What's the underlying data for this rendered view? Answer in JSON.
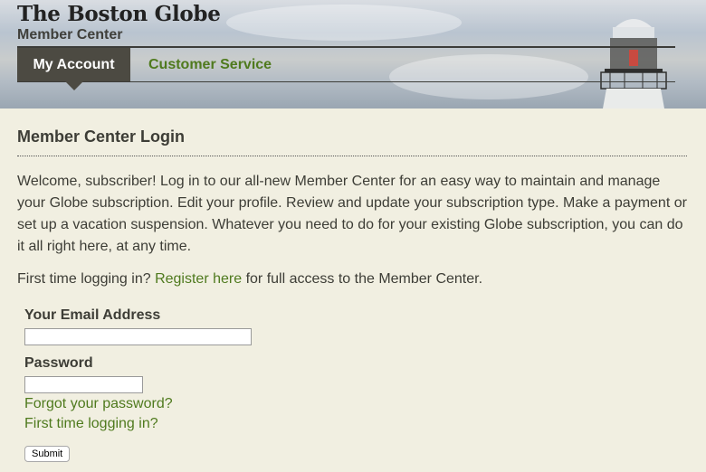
{
  "header": {
    "logo": "The Boston Globe",
    "subtitle": "Member Center",
    "tabs": [
      {
        "label": "My Account"
      },
      {
        "label": "Customer Service"
      }
    ]
  },
  "main": {
    "title": "Member Center Login",
    "intro": "Welcome, subscriber! Log in to our all-new Member Center for an easy way to maintain and manage your Globe subscription. Edit your profile. Review and update your subscription type. Make a payment or set up a vacation suspension. Whatever you need to do for your existing Globe subscription, you can do it all right here, at any time.",
    "first_prefix": "First time logging in?",
    "register_link": "Register here",
    "first_suffix": "for full access to the Member Center."
  },
  "form": {
    "email_label": "Your Email Address",
    "email_value": "",
    "password_label": "Password",
    "password_value": "",
    "forgot_link": "Forgot your password?",
    "first_time_link": "First time logging in?",
    "submit_label": "Submit"
  },
  "colors": {
    "background": "#f1efe1",
    "accent_green": "#4f7a1e",
    "tab_dark": "#4c4a42"
  }
}
